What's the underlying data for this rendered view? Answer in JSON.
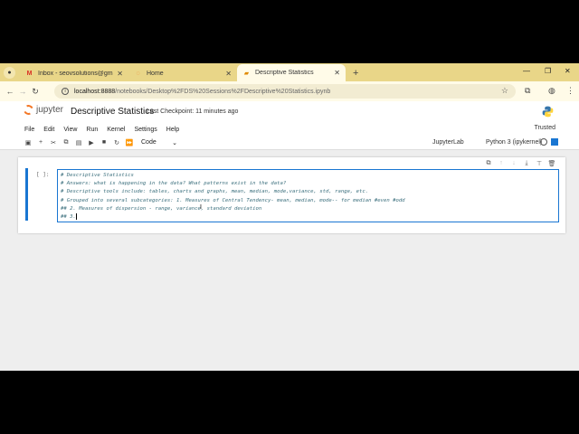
{
  "browser": {
    "tabs": [
      {
        "label": "Inbox - seovsolutions@gmai...",
        "active": false,
        "icon": "gmail-icon"
      },
      {
        "label": "Home",
        "active": false,
        "icon": "jupyter-favicon"
      },
      {
        "label": "Descriptive Statistics",
        "active": true,
        "icon": "notebook-favicon"
      }
    ],
    "url_host": "localhost:8888",
    "url_path": "/notebooks/Desktop%2FDS%20Sessions%2FDescriptive%20Statistics.ipynb"
  },
  "jupyter": {
    "logo_text": "jupyter",
    "notebook_title": "Descriptive Statistics",
    "checkpoint": "Last Checkpoint: 11 minutes ago",
    "menu": [
      "File",
      "Edit",
      "View",
      "Run",
      "Kernel",
      "Settings",
      "Help"
    ],
    "trusted": "Trusted",
    "cell_type": "Code",
    "jupyterlab": "JupyterLab",
    "kernel": "Python 3 (ipykernel)"
  },
  "cell": {
    "prompt": "[ ]:",
    "lines": [
      "# Descriptive Statistics",
      "# Answers: what is happening in the data? What patterns exist in the data?",
      "# Descriptive tools include: tables, charts and graphs, mean, median, mode,variance, std, range, etc.",
      "# Grouped into several subcategories: 1. Measures of Central Tendency- mean, median, mode-- for median #even #odd",
      "## 2. Measures of dispersion - range, variance, standard deviation",
      "## 3."
    ]
  },
  "colors": {
    "tab_strip": "#e9d688",
    "accent_blue": "#1976d2",
    "jupyter_orange": "#f37726"
  }
}
